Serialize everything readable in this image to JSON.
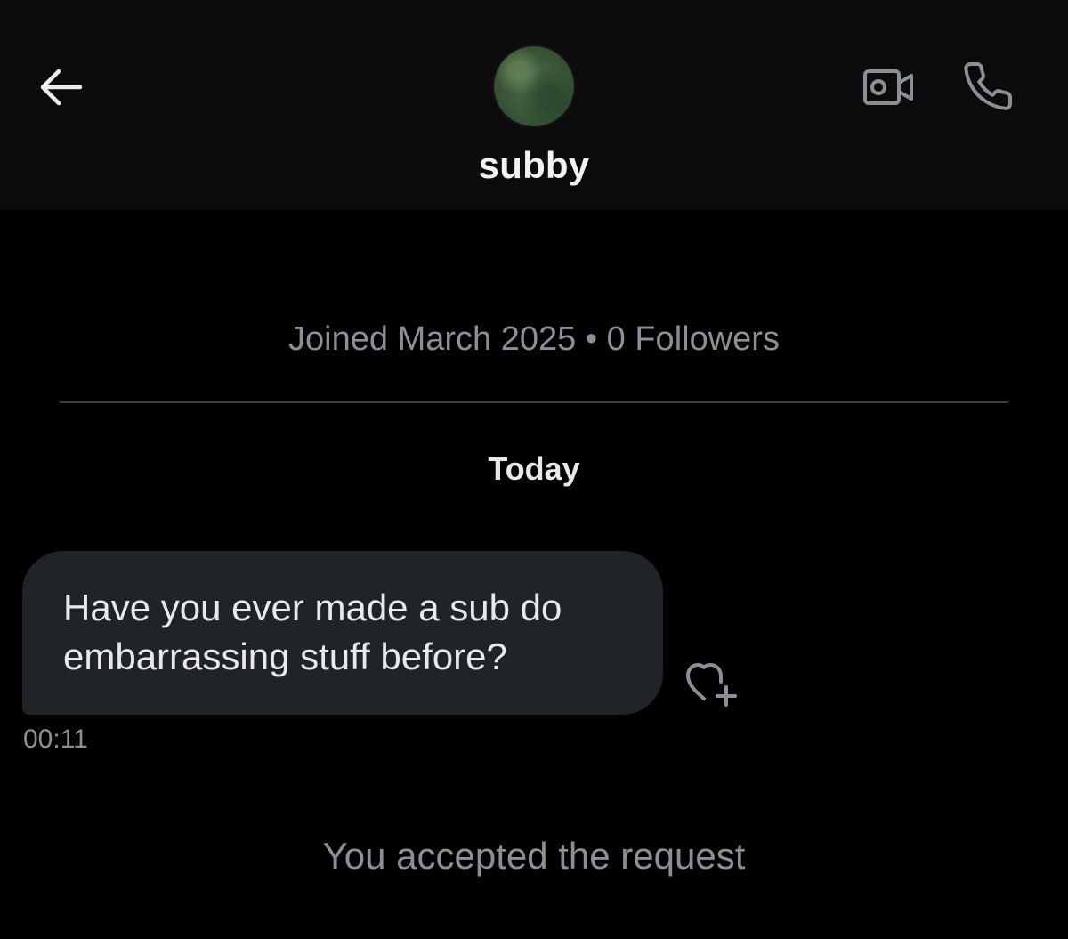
{
  "header": {
    "username": "subby",
    "back_icon": "arrow-left-icon",
    "video_icon": "video-camera-icon",
    "call_icon": "phone-icon"
  },
  "profile": {
    "info": "Joined March 2025 • 0 Followers"
  },
  "conversation": {
    "date_separator": "Today",
    "messages": [
      {
        "text": "Have you ever made a sub do embarrassing stuff before?",
        "time": "00:11",
        "react_icon": "heart-plus-icon"
      }
    ],
    "system_message": "You accepted the request"
  },
  "colors": {
    "background": "#000000",
    "header_background": "#0b0b0b",
    "bubble_background": "#202327",
    "primary_text": "#e7e9ea",
    "secondary_text": "#8b9096",
    "icon": "#8b9096"
  }
}
